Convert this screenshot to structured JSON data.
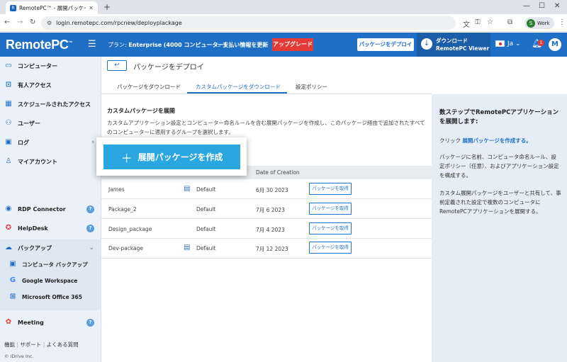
{
  "browser": {
    "tab_title": "RemotePC™ - 展開パッケージ",
    "url": "login.remotepc.com/rpcnew/deployplackage",
    "profile_label": "Work",
    "profile_initial": "S"
  },
  "header": {
    "logo": "RemotePC",
    "plan_label": "プラン:",
    "plan_value": "Enterprise",
    "plan_detail": "(4000 コンピューター)",
    "renew_label": "支払い情報を更新",
    "upgrade_label": "アップグレード",
    "deploy_button": "パッケージをデプロイ",
    "download_line1": "ダウンロード",
    "download_line2": "RemotePC Viewer",
    "language": "Ja",
    "notification_count": "1",
    "avatar_initial": "M",
    "accent_color": "#1f6fc6",
    "upgrade_color": "#e53935"
  },
  "sidebar": {
    "items": [
      {
        "label": "コンピューター",
        "icon": "computer-icon"
      },
      {
        "label": "有人アクセス",
        "icon": "attended-access-icon"
      },
      {
        "label": "スケジュールされたアクセス",
        "icon": "calendar-icon"
      },
      {
        "label": "ユーザー",
        "icon": "user-icon"
      },
      {
        "label": "ログ",
        "icon": "log-icon"
      },
      {
        "label": "マイアカウント",
        "icon": "account-icon"
      }
    ],
    "rdp_connector": "RDP Connector",
    "helpdesk": "HelpDesk",
    "backup": "バックアップ",
    "backup_items": [
      "コンピュータ バックアップ",
      "Google Workspace",
      "Microsoft Office 365"
    ],
    "meeting": "Meeting",
    "footer_links": [
      "機能",
      "サポート",
      "よくある質問"
    ],
    "copyright": "© IDrive Inc."
  },
  "content": {
    "back_icon": "back-arrow-icon",
    "title": "パッケージをデプロイ",
    "tabs": [
      "パッケージをダウンロード",
      "カスタムパッケージをダウンロード",
      "設定ポリシー"
    ],
    "active_tab": 1,
    "section_title": "カスタムパッケージを展開",
    "section_desc": "カスタムアプリケーション設定とコンピューター命名ルールを含む展開パッケージを作成し、このパッケージ経由で追加されたすべてのコンピューターに適用するグループを選択します。",
    "create_button": "展開パッケージを作成",
    "table": {
      "date_header": "Date of Creation",
      "rows": [
        {
          "name": "James",
          "has_icon": true,
          "group": "Default",
          "date": "6月 30 2023",
          "action": "パッケージを取得"
        },
        {
          "name": "Package_2",
          "has_icon": false,
          "group": "Default",
          "date": "7月 6 2023",
          "action": "パッケージを取得"
        },
        {
          "name": "Design_package",
          "has_icon": false,
          "group": "Default",
          "date": "7月 4 2023",
          "action": "パッケージを取得"
        },
        {
          "name": "Dev-package",
          "has_icon": true,
          "group": "Default",
          "date": "7月 12 2023",
          "action": "パッケージを取得"
        }
      ]
    }
  },
  "right_panel": {
    "title": "数ステップでRemotePCアプリケーションを展開します:",
    "p1_prefix": "クリック",
    "p1_link": "展開パッケージを作成する。",
    "p2": "パッケージに名前、コンピュータ命名ルール、設定ポリシー（任意）、およびアプリケーション設定を構成する。",
    "p3": "カスタム展開パッケージをユーザーと共有して、事前定義された設定で複数のコンピュータにRemotePCアプリケーションを展開する。"
  }
}
